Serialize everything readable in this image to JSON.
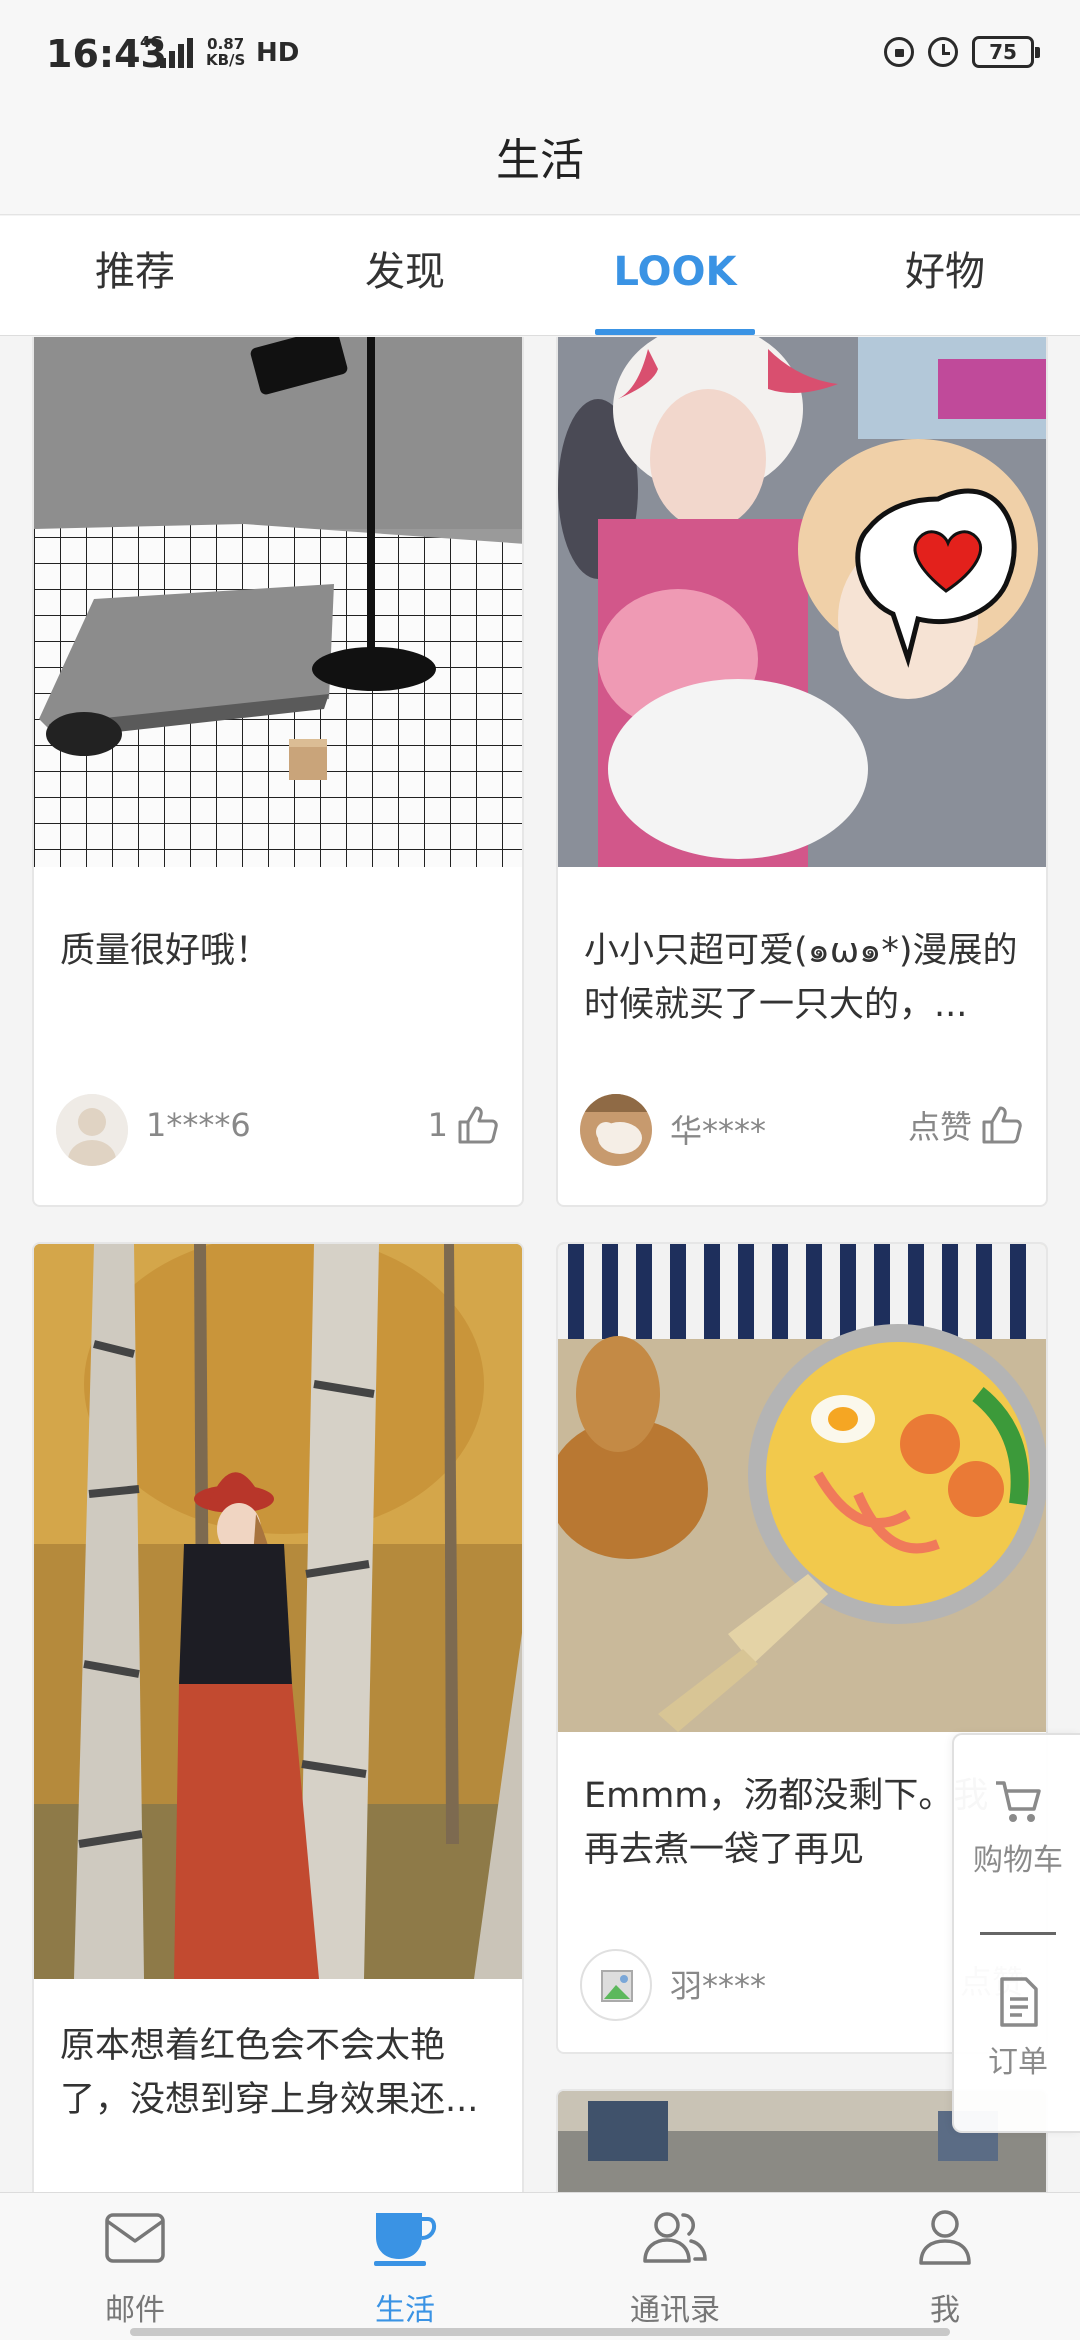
{
  "status_bar": {
    "time": "16:43",
    "network_top": "4G",
    "network_speed_value": "0.87",
    "network_speed_unit": "KB/S",
    "hd_label": "HD",
    "battery": "75"
  },
  "header": {
    "title": "生活"
  },
  "tabs": [
    {
      "label": "推荐",
      "active": false
    },
    {
      "label": "发现",
      "active": false
    },
    {
      "label": "LOOK",
      "active": true
    },
    {
      "label": "好物",
      "active": false
    }
  ],
  "posts": [
    {
      "text": "质量很好哦！",
      "user": "1****6",
      "likes": "1"
    },
    {
      "text": "小小只超可爱(๑ω๑*)漫展的时候就买了一只大的，...",
      "user": "华****",
      "likes": "点赞"
    },
    {
      "text": "原本想着红色会不会太艳了，没想到穿上身效果还...",
      "user": "",
      "likes": ""
    },
    {
      "text": "Emmm，汤都没剩下。我再去煮一袋了再见",
      "user": "羽****",
      "likes": "点赞"
    }
  ],
  "float_panel": {
    "cart_label": "购物车",
    "order_label": "订单"
  },
  "bottom_nav": [
    {
      "label": "邮件",
      "icon": "mail-icon",
      "active": false
    },
    {
      "label": "生活",
      "icon": "cup-icon",
      "active": true
    },
    {
      "label": "通讯录",
      "icon": "contacts-icon",
      "active": false
    },
    {
      "label": "我",
      "icon": "person-icon",
      "active": false
    }
  ],
  "colors": {
    "accent": "#3a93e4"
  }
}
